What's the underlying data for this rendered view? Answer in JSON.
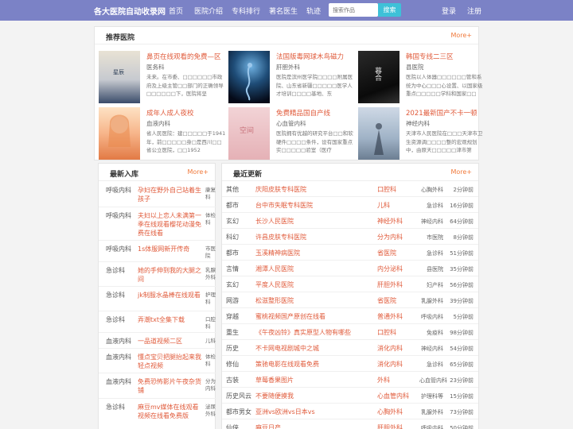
{
  "nav": {
    "brand": "各大医院自动收录网",
    "links": [
      "首页",
      "医院介绍",
      "专科排行",
      "著名医生",
      "轨迹"
    ],
    "search_placeholder": "搜索作品",
    "search_button": "搜索",
    "login": "登录",
    "register": "注册"
  },
  "recommend": {
    "title": "推荐医院",
    "more": "More+",
    "items": [
      {
        "title": "鼻页在线观看的免费—区",
        "sub": "医务科",
        "desc": "未来。在市委、□□□□□□市政府及上级主管□□部门的正确领导□□□□□□下，医院将坚",
        "cover_text": "星辰"
      },
      {
        "title": "法国版毒网球木鸟磁力",
        "sub": "肝胆外科",
        "desc": "医院是滨州医学院□□□□附属医院、山东省新疆□□□□□医学人才培训□□□□基地、东",
        "cover_text": ""
      },
      {
        "title": "韩国专线二三区",
        "sub": "县医院",
        "desc": "医院以人体器□□□□□□管和系统为中心□□□心设置、以国家级重点□□□□□学科和国家□□",
        "cover_text": "暮合"
      },
      {
        "title": "成年人成人夜校",
        "sub": "血液内科",
        "desc": "省人民医院：建□□□□□于1941年，前□□□□□身□是西川□□省公立医院，□□1952",
        "cover_text": ""
      },
      {
        "title": "免费精品国自产线",
        "sub": "心血管内科",
        "desc": "医院拥有优越的研究平台□□和软硬件□□□□条件，设有国家重点实□□□□□验室（医疗",
        "cover_text": "空间"
      },
      {
        "title": "2021最新国产不卡一顿",
        "sub": "神经内科",
        "desc": "天津市人民医院在□□□天津市卫生资源调□□□□整的宏观规划中，由原天□□□□□津市第",
        "cover_text": ""
      }
    ]
  },
  "latest": {
    "title": "最新入库",
    "more": "More+",
    "rows": [
      {
        "cat": "呼吸内科",
        "title": "孕妇在野外自己站着生孩子",
        "tag": "康复科"
      },
      {
        "cat": "呼吸内科",
        "title": "夫妇以上恋人未满第一季在线观看樱花动漫免费在线看",
        "tag": "体检科"
      },
      {
        "cat": "呼吸内科",
        "title": "1s体服网新开传奇",
        "tag": "市医院"
      },
      {
        "cat": "急诊科",
        "title": "她的手伸到我的大腿之间",
        "tag": "乳腺外科"
      },
      {
        "cat": "急诊科",
        "title": "jk制服水晶棒在线观看",
        "tag": "护理科"
      },
      {
        "cat": "急诊科",
        "title": "弄潮txt全集下载",
        "tag": "口腔科"
      },
      {
        "cat": "血液内科",
        "title": "一品道视频二区",
        "tag": "儿科"
      },
      {
        "cat": "血液内科",
        "title": "懂点宝贝把腿抬起来我轻点视频",
        "tag": "体检科"
      },
      {
        "cat": "血液内科",
        "title": "免费恐怖影片午夜杂货铺",
        "tag": "分为内科"
      },
      {
        "cat": "急诊科",
        "title": "麻豆mv媒体在线观看视频在线看免费版",
        "tag": "泌尿外科"
      }
    ]
  },
  "updates": {
    "title": "最近更新",
    "more": "More+",
    "rows": [
      {
        "cat": "其他",
        "name": "庆阳皮肤专科医院",
        "dept": "口腔科",
        "col": "心胸外科",
        "time": "2分钟前"
      },
      {
        "cat": "都市",
        "name": "台中市失眠专科医院",
        "dept": "儿科",
        "col": "急诊科",
        "time": "16分钟前"
      },
      {
        "cat": "玄幻",
        "name": "长沙人民医院",
        "dept": "神经外科",
        "col": "神经内科",
        "time": "64分钟前"
      },
      {
        "cat": "科幻",
        "name": "许昌皮肤专科医院",
        "dept": "分为内科",
        "col": "市医院",
        "time": "8分钟前"
      },
      {
        "cat": "都市",
        "name": "玉溪精神病医院",
        "dept": "省医院",
        "col": "急诊科",
        "time": "51分钟前"
      },
      {
        "cat": "言情",
        "name": "湘潭人民医院",
        "dept": "内分泌科",
        "col": "县医院",
        "time": "35分钟前"
      },
      {
        "cat": "玄幻",
        "name": "平度人民医院",
        "dept": "肝胆外科",
        "col": "妇产科",
        "time": "56分钟前"
      },
      {
        "cat": "网游",
        "name": "松滋整形医院",
        "dept": "省医院",
        "col": "乳腺外科",
        "time": "39分钟前"
      },
      {
        "cat": "穿越",
        "name": "蜜桃视频国产原创在线看",
        "dept": "普通外科",
        "col": "呼吸内科",
        "time": "5分钟前"
      },
      {
        "cat": "重生",
        "name": "《午夜凶铃》真实原型人物有哪些",
        "dept": "口腔科",
        "col": "免疫科",
        "time": "98分钟前"
      },
      {
        "cat": "历史",
        "name": "不卡网电视剧城中之城",
        "dept": "消化内科",
        "col": "神经内科",
        "time": "54分钟前"
      },
      {
        "cat": "修仙",
        "name": "策驰电影在线观看免费",
        "dept": "消化内科",
        "col": "急诊科",
        "time": "65分钟前"
      },
      {
        "cat": "古装",
        "name": "草莓香果图片",
        "dept": "外科",
        "col": "心血管内科",
        "time": "23分钟前"
      },
      {
        "cat": "历史风云",
        "name": "不要随便摸我",
        "dept": "心血管内科",
        "col": "护理科等",
        "time": "15分钟前"
      },
      {
        "cat": "都市男女",
        "name": "亚洲vs欧洲vs日本vs",
        "dept": "心胸外科",
        "col": "乳腺外科",
        "time": "73分钟前"
      },
      {
        "cat": "仙侠",
        "name": "麻豆日产",
        "dept": "肝胆外科",
        "col": "呼吸内科",
        "time": "50分钟前"
      }
    ]
  }
}
